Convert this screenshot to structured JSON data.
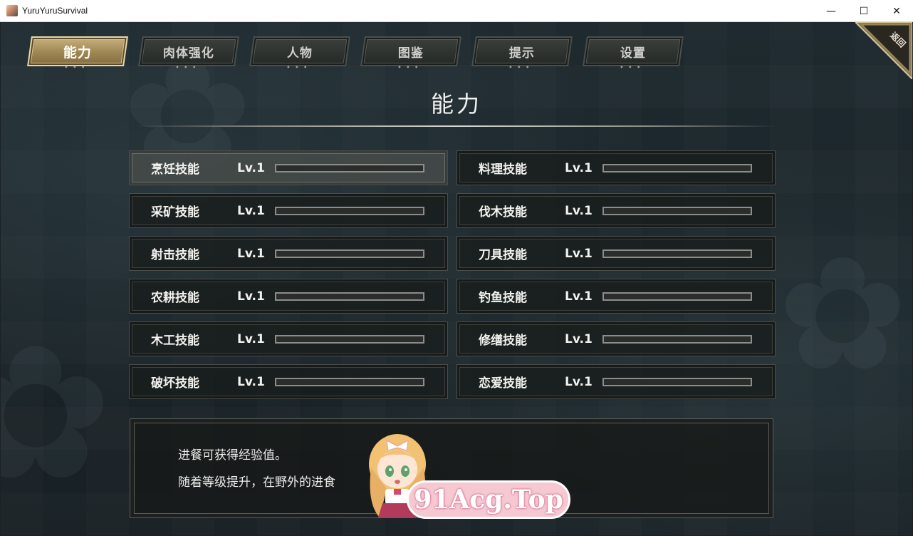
{
  "window": {
    "title": "YuruYuruSurvival",
    "controls": {
      "minimize": "—",
      "maximize": "☐",
      "close": "✕"
    }
  },
  "tabs": [
    {
      "label": "能力",
      "active": true
    },
    {
      "label": "肉体强化",
      "active": false
    },
    {
      "label": "人物",
      "active": false
    },
    {
      "label": "图鉴",
      "active": false
    },
    {
      "label": "提示",
      "active": false
    },
    {
      "label": "设置",
      "active": false
    }
  ],
  "back_button": {
    "label": "返回"
  },
  "page": {
    "title": "能力"
  },
  "skills": [
    {
      "name": "烹饪技能",
      "level": "Lv.1",
      "progress": 0
    },
    {
      "name": "料理技能",
      "level": "Lv.1",
      "progress": 0
    },
    {
      "name": "采矿技能",
      "level": "Lv.1",
      "progress": 0
    },
    {
      "name": "伐木技能",
      "level": "Lv.1",
      "progress": 0
    },
    {
      "name": "射击技能",
      "level": "Lv.1",
      "progress": 0
    },
    {
      "name": "刀具技能",
      "level": "Lv.1",
      "progress": 0
    },
    {
      "name": "农耕技能",
      "level": "Lv.1",
      "progress": 0
    },
    {
      "name": "钓鱼技能",
      "level": "Lv.1",
      "progress": 0
    },
    {
      "name": "木工技能",
      "level": "Lv.1",
      "progress": 0
    },
    {
      "name": "修缮技能",
      "level": "Lv.1",
      "progress": 0
    },
    {
      "name": "破坏技能",
      "level": "Lv.1",
      "progress": 0
    },
    {
      "name": "恋爱技能",
      "level": "Lv.1",
      "progress": 0
    }
  ],
  "description": {
    "line1": "进餐可获得经验值。",
    "line2": "随着等级提升，在野外的进食"
  },
  "watermark": {
    "text": "91Acg.Top"
  },
  "colors": {
    "accent": "#c9b37d",
    "panel": "#181c1b",
    "text": "#f2f2ee"
  }
}
